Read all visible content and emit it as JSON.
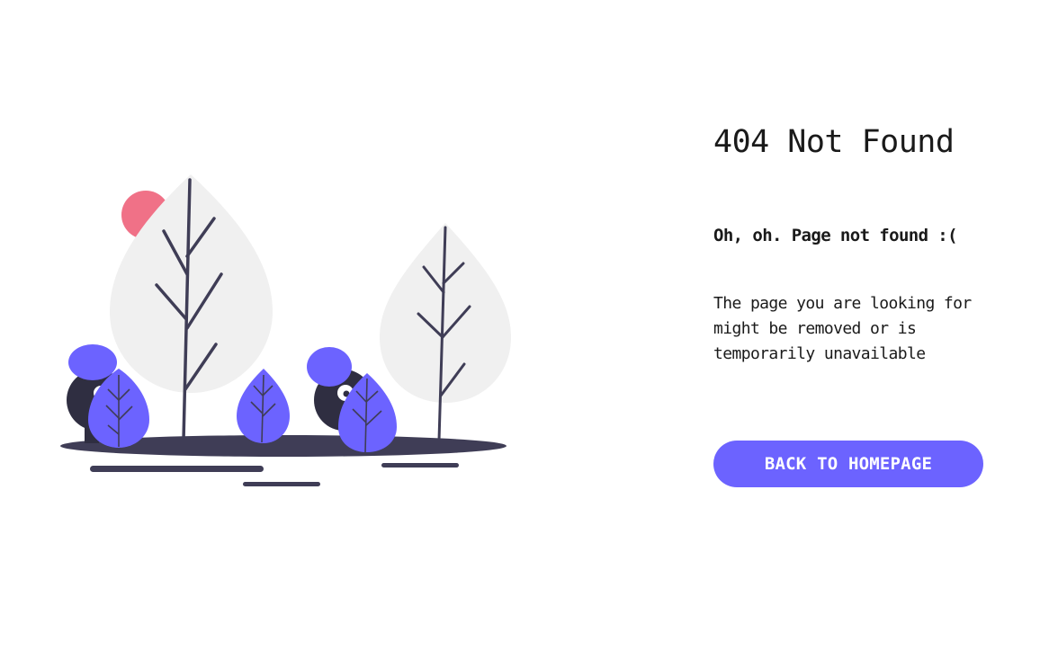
{
  "page": {
    "title": "404 Not Found",
    "subtitle": "Oh, oh. Page not found :(",
    "message": "The page you are looking for might be removed or is temporarily unavailable",
    "button_label": "BACK TO HOMEPAGE"
  },
  "colors": {
    "accent": "#6c63ff",
    "sun": "#f07187",
    "tree_foliage": "#f0f0f0",
    "dark": "#3f3d56",
    "figure_body": "#2f2e41"
  },
  "illustration": {
    "icon": "forest-hide-and-seek-illustration"
  }
}
